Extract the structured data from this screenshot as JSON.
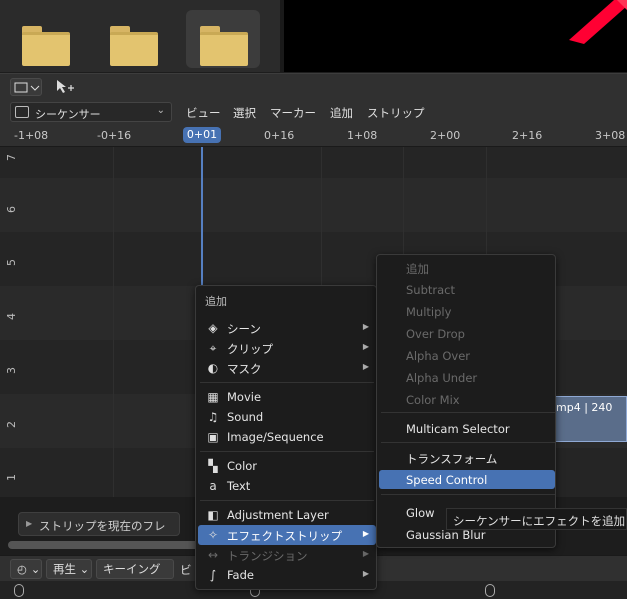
{
  "header": {
    "editor_type": "シーケンサー",
    "menus": [
      "ビュー",
      "選択",
      "マーカー",
      "追加",
      "ストリップ"
    ]
  },
  "ruler": {
    "ticks": [
      "-1+08",
      "-0+16",
      "0+01",
      "0+16",
      "1+08",
      "2+00",
      "2+16",
      "3+08"
    ],
    "current_frame": "0+01"
  },
  "channels": [
    "7",
    "6",
    "5",
    "4",
    "3",
    "2",
    "1"
  ],
  "strip": {
    "label": "mp4 | 240"
  },
  "add_menu": {
    "title": "追加",
    "items": [
      {
        "label": "シーン",
        "icon": "scene-icon",
        "submenu": true
      },
      {
        "label": "クリップ",
        "icon": "clip-icon",
        "submenu": true
      },
      {
        "label": "マスク",
        "icon": "mask-icon",
        "submenu": true
      },
      {
        "label": "Movie",
        "icon": "movie-icon",
        "submenu": false
      },
      {
        "label": "Sound",
        "icon": "sound-icon",
        "submenu": false
      },
      {
        "label": "Image/Sequence",
        "icon": "image-icon",
        "submenu": false
      },
      {
        "label": "Color",
        "icon": "color-icon",
        "submenu": false
      },
      {
        "label": "Text",
        "icon": "text-icon",
        "submenu": false
      },
      {
        "label": "Adjustment Layer",
        "icon": "adjustment-icon",
        "submenu": false
      },
      {
        "label": "エフェクトストリップ",
        "icon": "effect-icon",
        "submenu": true
      },
      {
        "label": "トランジション",
        "icon": "transition-icon",
        "submenu": true
      },
      {
        "label": "Fade",
        "icon": "fade-icon",
        "submenu": true
      }
    ]
  },
  "effect_menu": {
    "items": [
      "追加",
      "Subtract",
      "Multiply",
      "Over Drop",
      "Alpha Over",
      "Alpha Under",
      "Color Mix",
      "Multicam Selector",
      "トランスフォーム",
      "Speed Control",
      "Glow",
      "Gaussian Blur"
    ]
  },
  "hover_tooltip": "シーケンサーにエフェクトを追加し",
  "bottom": {
    "strip_to_frame": "ストリップを現在のフレ",
    "playback": "再生",
    "keying": "キーイング",
    "view": "ビ"
  },
  "colors": {
    "accent": "#4772b3",
    "folder": "#e3c46f",
    "preview_red": "#ff0033"
  }
}
